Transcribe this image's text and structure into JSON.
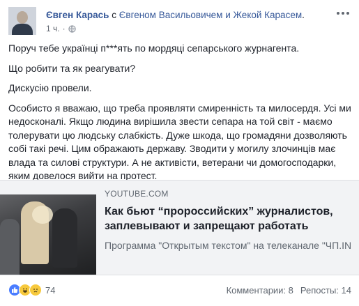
{
  "post": {
    "author": "Євген Карась",
    "with_text": "с",
    "tagged": "Євгеном Васильовичем и Жекой Карасем",
    "tagged_end": ".",
    "time": "1 ч.",
    "dot": "·",
    "paragraphs": [
      "Поруч тебе українці п***ять по мордяці сепарського журнагента.",
      "Що робити та як реагувати?",
      "Дискусію провели.",
      "Особисто я вважаю, що треба проявляти смиренність та милосердя. Усі ми недосконалі. Якщо людина вирішила звести сепара на той світ - маємо толерувати цю людську слабкість. Дуже шкода, що громадяни дозволяють собі такі речі. Цим ображають державу. Зводити у могилу злочинців має влада та силові структури. А не активісти, ветерани чи домогосподарки, яким довелося вийти на протест."
    ]
  },
  "link_card": {
    "domain": "YOUTUBE.COM",
    "title": "Как бьют “пророссийских” журналистов, заплевывают и запрещают работать",
    "description": "Программа \"Открытым текстом\" на телеканале \"ЧП.INFO\". Гости студии: - Евген Карась, лидер..."
  },
  "footer": {
    "reaction_count": "74",
    "comments": "Комментарии: 8",
    "shares": "Репосты: 14"
  },
  "icons": {
    "globe": "globe-icon",
    "more": "more-icon",
    "like": "like-icon",
    "haha": "haha-icon",
    "sad": "sad-icon"
  },
  "colors": {
    "link_blue": "#365899",
    "text": "#1d2129",
    "muted": "#606770",
    "card_bg": "#f2f3f5",
    "like_blue": "#4a7dff",
    "emoji_yellow": "#f7c93d"
  }
}
